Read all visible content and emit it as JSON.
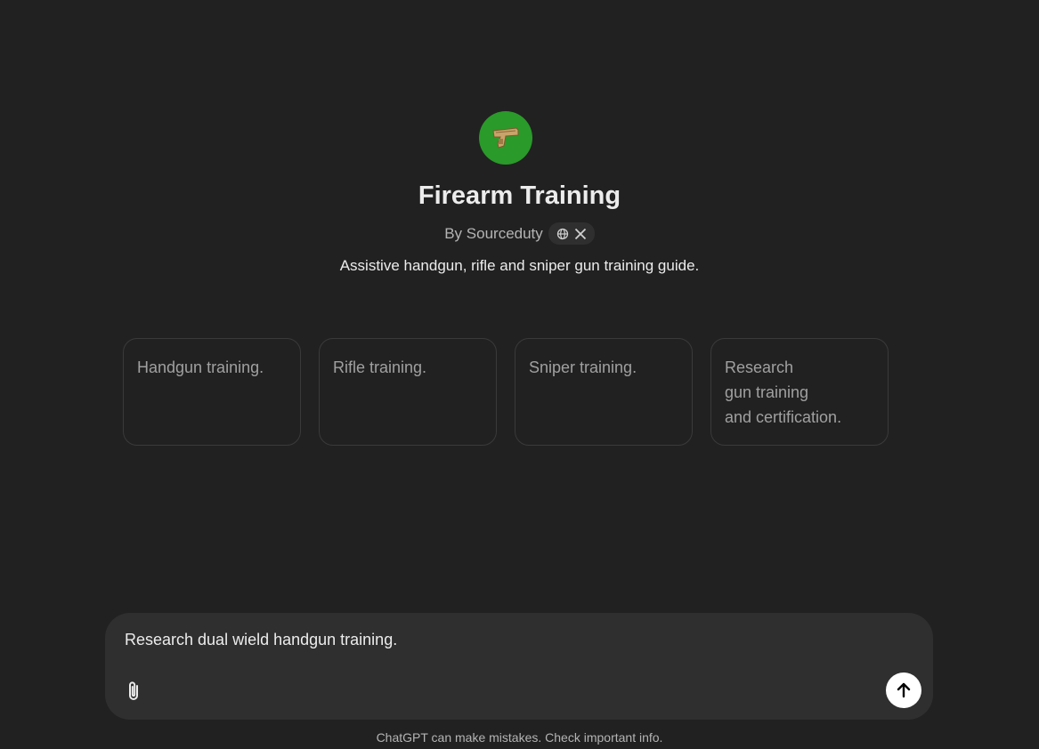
{
  "gpt": {
    "avatar_icon": "handgun-icon",
    "avatar_color": "#2a9a2a",
    "name": "Firearm Training",
    "byline": "By Sourceduty",
    "social_links": [
      "globe-icon",
      "x-icon"
    ],
    "description": "Assistive handgun, rifle and sniper gun training guide."
  },
  "suggestions": [
    {
      "lines": [
        "Handgun training."
      ]
    },
    {
      "lines": [
        "Rifle training."
      ]
    },
    {
      "lines": [
        "Sniper training."
      ]
    },
    {
      "lines": [
        "Research",
        "gun training",
        "and certification."
      ]
    }
  ],
  "composer": {
    "value": "Research dual wield handgun training.",
    "attach_icon": "paperclip-icon",
    "send_icon": "arrow-up-icon"
  },
  "footer": {
    "disclaimer": "ChatGPT can make mistakes. Check important info."
  }
}
